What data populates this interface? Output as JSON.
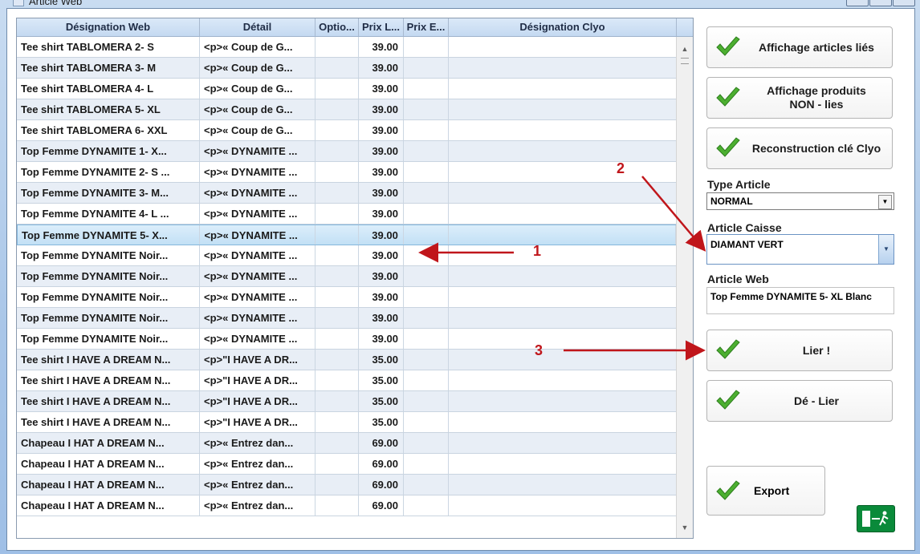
{
  "window": {
    "title": "Article Web"
  },
  "grid": {
    "columns": [
      "Désignation Web",
      "Détail",
      "Optio...",
      "Prix L...",
      "Prix E...",
      "Désignation Clyo"
    ],
    "rows": [
      {
        "designation": "Tee shirt TABLOMERA 2- S",
        "detail": "<p>« Coup de G...",
        "prix": "39.00"
      },
      {
        "designation": "Tee shirt TABLOMERA 3- M",
        "detail": "<p>« Coup de G...",
        "prix": "39.00"
      },
      {
        "designation": "Tee shirt TABLOMERA 4- L",
        "detail": "<p>« Coup de G...",
        "prix": "39.00"
      },
      {
        "designation": "Tee shirt TABLOMERA 5- XL",
        "detail": "<p>« Coup de G...",
        "prix": "39.00"
      },
      {
        "designation": "Tee shirt TABLOMERA 6- XXL",
        "detail": "<p>« Coup de G...",
        "prix": "39.00"
      },
      {
        "designation": "Top Femme DYNAMITE 1- X...",
        "detail": "<p>« DYNAMITE ...",
        "prix": "39.00"
      },
      {
        "designation": "Top Femme DYNAMITE 2- S ...",
        "detail": "<p>« DYNAMITE ...",
        "prix": "39.00"
      },
      {
        "designation": "Top Femme DYNAMITE 3- M...",
        "detail": "<p>« DYNAMITE ...",
        "prix": "39.00"
      },
      {
        "designation": "Top Femme DYNAMITE 4- L ...",
        "detail": "<p>« DYNAMITE ...",
        "prix": "39.00"
      },
      {
        "designation": "Top Femme DYNAMITE 5- X...",
        "detail": "<p>« DYNAMITE ...",
        "prix": "39.00"
      },
      {
        "designation": "Top Femme DYNAMITE Noir...",
        "detail": "<p>« DYNAMITE ...",
        "prix": "39.00"
      },
      {
        "designation": "Top Femme DYNAMITE Noir...",
        "detail": "<p>« DYNAMITE ...",
        "prix": "39.00"
      },
      {
        "designation": "Top Femme DYNAMITE Noir...",
        "detail": "<p>« DYNAMITE ...",
        "prix": "39.00"
      },
      {
        "designation": "Top Femme DYNAMITE Noir...",
        "detail": "<p>« DYNAMITE ...",
        "prix": "39.00"
      },
      {
        "designation": "Top Femme DYNAMITE Noir...",
        "detail": "<p>« DYNAMITE ...",
        "prix": "39.00"
      },
      {
        "designation": "Tee shirt I HAVE A DREAM N...",
        "detail": "<p>\"I HAVE A DR...",
        "prix": "35.00"
      },
      {
        "designation": "Tee shirt I HAVE A DREAM N...",
        "detail": "<p>\"I HAVE A DR...",
        "prix": "35.00"
      },
      {
        "designation": "Tee shirt I HAVE A DREAM N...",
        "detail": "<p>\"I HAVE A DR...",
        "prix": "35.00"
      },
      {
        "designation": "Tee shirt I HAVE A DREAM N...",
        "detail": "<p>\"I HAVE A DR...",
        "prix": "35.00"
      },
      {
        "designation": "Chapeau I HAT  A DREAM N...",
        "detail": "<p>« Entrez dan...",
        "prix": "69.00"
      },
      {
        "designation": "Chapeau I HAT  A DREAM N...",
        "detail": "<p>« Entrez dan...",
        "prix": "69.00"
      },
      {
        "designation": "Chapeau I HAT  A DREAM N...",
        "detail": "<p>« Entrez dan...",
        "prix": "69.00"
      },
      {
        "designation": "Chapeau I HAT  A DREAM N...",
        "detail": "<p>« Entrez dan...",
        "prix": "69.00"
      }
    ],
    "selected_row": 9
  },
  "buttons": {
    "affichage_lies": "Affichage articles liés",
    "affichage_non_lies": "Affichage produits\nNON - lies",
    "reconstruction": "Reconstruction clé Clyo",
    "lier": "Lier !",
    "delier": "Dé - Lier",
    "export": "Export"
  },
  "fields": {
    "type_article_label": "Type Article",
    "type_article_value": "NORMAL",
    "article_caisse_label": "Article Caisse",
    "article_caisse_value": "DIAMANT VERT",
    "article_web_label": "Article Web",
    "article_web_value": "Top Femme DYNAMITE 5- XL Blanc"
  },
  "annotations": {
    "a1": "1",
    "a2": "2",
    "a3": "3"
  },
  "colors": {
    "annotation": "#c0161b",
    "check": "#4caf30",
    "exit": "#0a8a3a"
  }
}
